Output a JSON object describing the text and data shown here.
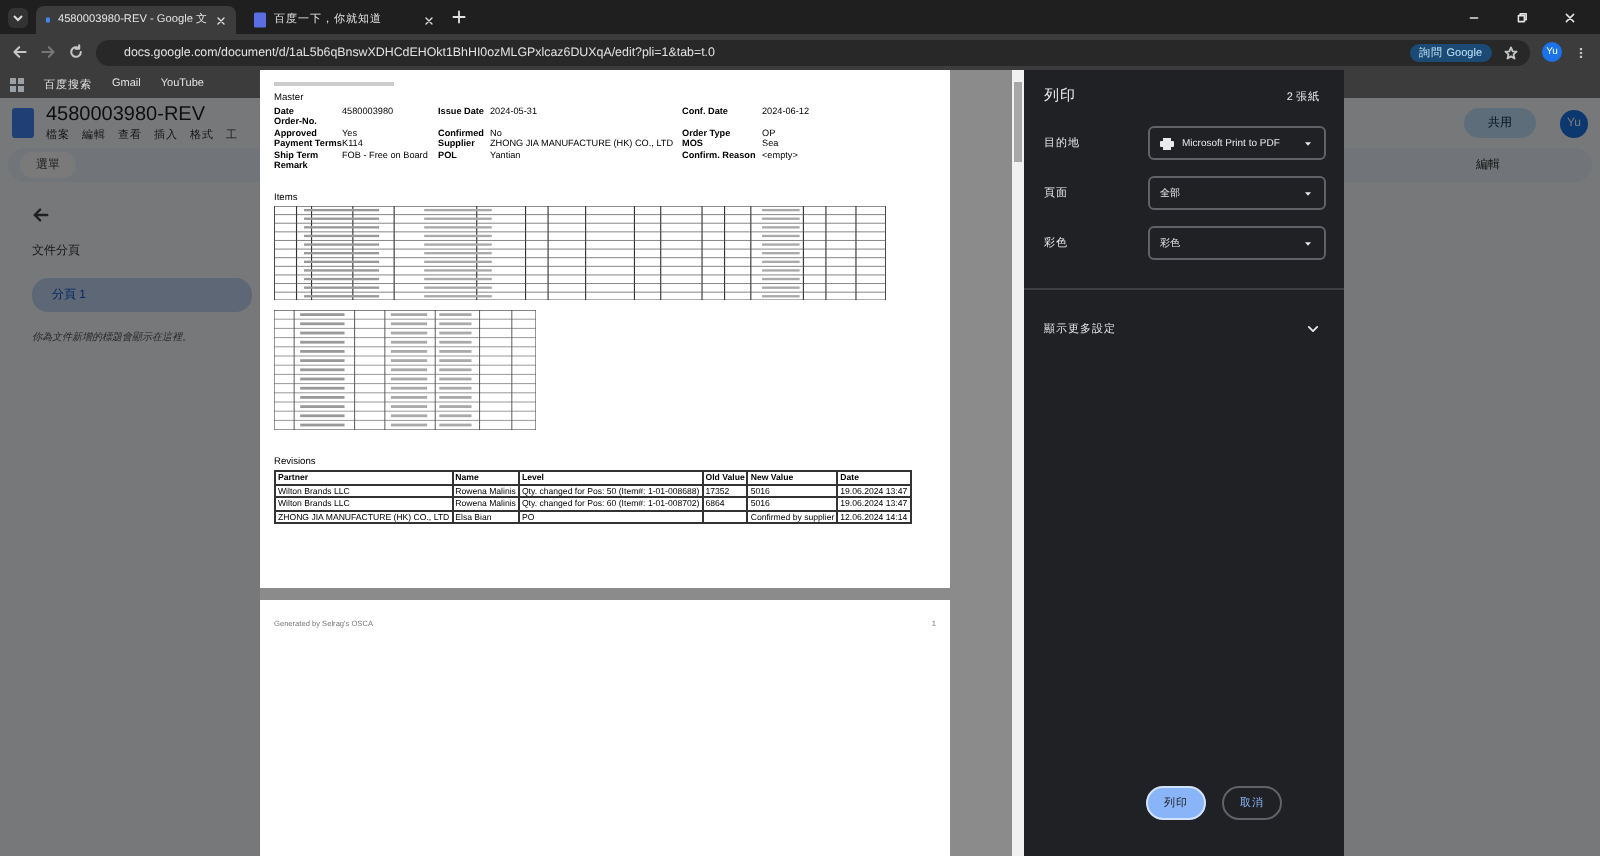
{
  "browser": {
    "tabs": [
      {
        "title": "4580003980-REV - Google 文",
        "selected": true
      },
      {
        "title": "百度一下，你就知道",
        "selected": false
      }
    ],
    "url": "docs.google.com/document/d/1aL5b6qBnswXDHCdEHOkt1BhHI0ozMLGPxlcaz6DUXqA/edit?pli=1&tab=t.0",
    "ask_chip": "詢問 Google",
    "avatar": "Yu",
    "bookmarks": [
      "百度搜索",
      "Gmail",
      "YouTube"
    ]
  },
  "docs": {
    "title": "4580003980-REV",
    "menus": [
      "檔案",
      "編輯",
      "查看",
      "插入",
      "格式",
      "工"
    ],
    "search_placeholder": "選單",
    "sidebar": {
      "heading": "文件分頁",
      "tabs": [
        {
          "label": "分頁 1",
          "selected": true
        }
      ],
      "hint": "你為文件新增的標題會顯示在這裡。"
    },
    "share": "共用",
    "avatar": "Yu",
    "mode": "編輯"
  },
  "preview": {
    "master_heading": "Master",
    "master": [
      [
        {
          "label": "Date",
          "value": "4580003980"
        },
        {
          "label": "Issue Date",
          "value": "2024-05-31"
        },
        {
          "label": "Conf. Date",
          "value": "2024-06-12"
        }
      ],
      [
        {
          "label": "Order-No."
        }
      ],
      [
        {
          "label": "Approved",
          "value": "Yes"
        },
        {
          "label": "Confirmed",
          "value": "No"
        },
        {
          "label": "Order Type",
          "value": "OP"
        }
      ],
      [
        {
          "label": "Payment Terms",
          "value": "K114"
        },
        {
          "label": "Supplier",
          "value": "ZHONG JIA MANUFACTURE (HK) CO., LTD"
        },
        {
          "label": "MOS",
          "value": "Sea"
        }
      ],
      [
        {
          "label": "Ship Term",
          "value": "FOB - Free on Board"
        },
        {
          "label": "POL",
          "value": "Yantian"
        },
        {
          "label": "Confirm. Reason",
          "value": "<empty>"
        }
      ],
      [
        {
          "label": "Remark"
        }
      ]
    ],
    "items_heading": "Items",
    "revisions_heading": "Revisions",
    "revisions": {
      "columns": [
        "Partner",
        "Name",
        "Level",
        "Old Value",
        "New Value",
        "Date"
      ],
      "rows": [
        [
          "Wilton Brands LLC",
          "Rowena Malinis",
          "Qty. changed for Pos: 50 (Item#: 1-01-008688)",
          "17352",
          "5016",
          "19.06.2024 13:47"
        ],
        [
          "Wilton Brands LLC",
          "Rowena Malinis",
          "Qty. changed for Pos: 60 (Item#: 1-01-008702)",
          "6864",
          "5016",
          "19.06.2024 13:47"
        ],
        [
          "ZHONG JIA MANUFACTURE (HK) CO., LTD",
          "Elsa Bian",
          "PO",
          null,
          "Confirmed by supplier",
          "12.06.2024 14:14"
        ]
      ]
    },
    "footer": "Generated by Selrag's OSCA",
    "page_number": "1"
  },
  "print": {
    "title": "列印",
    "sheets": "2 張紙",
    "settings": [
      {
        "label": "目的地",
        "value": "Microsoft Print to PDF",
        "kind": "printer"
      },
      {
        "label": "頁面",
        "value": "全部",
        "kind": "select"
      },
      {
        "label": "彩色",
        "value": "彩色",
        "kind": "select"
      }
    ],
    "more": "顯示更多設定",
    "print_button": "列印",
    "cancel_button": "取消"
  }
}
